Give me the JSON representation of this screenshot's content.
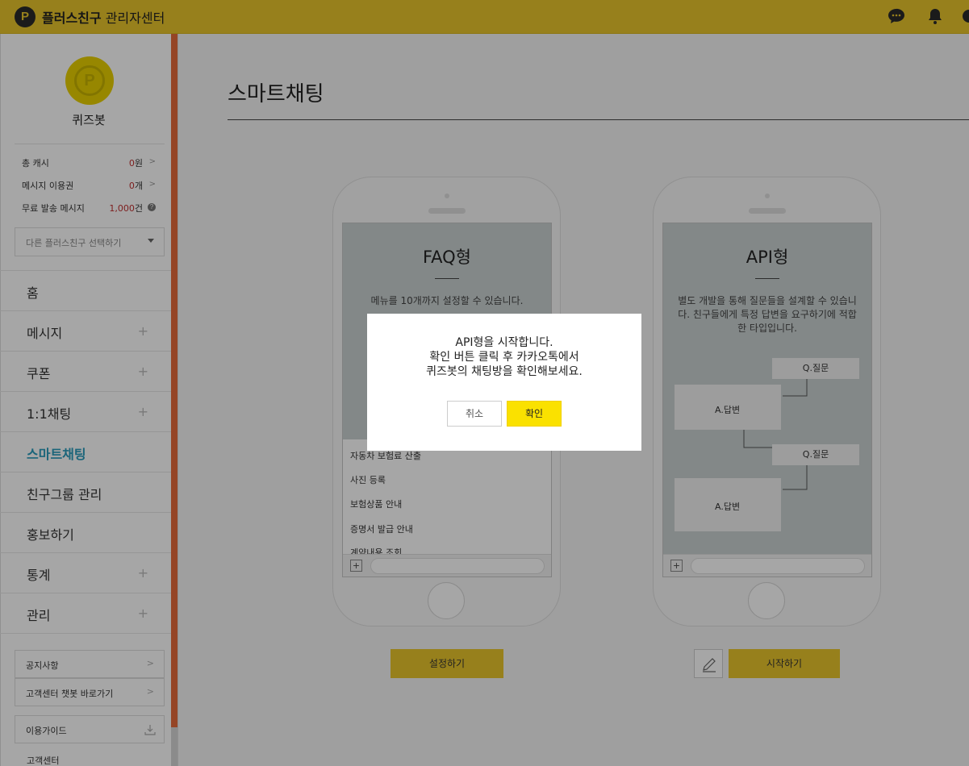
{
  "header": {
    "logo_glyph": "P",
    "brand_bold": "플러스친구",
    "brand_rest": " 관리자센터",
    "icons": [
      "chat-icon",
      "bell-icon",
      "settings-icon"
    ],
    "accent_color": "#e8c52b"
  },
  "profile": {
    "name": "퀴즈봇",
    "avatar_glyph": "P"
  },
  "stats": [
    {
      "label": "총 캐시",
      "value": "0",
      "unit": "원",
      "action": "chevron-right-icon"
    },
    {
      "label": "메시지 이용권",
      "value": "0",
      "unit": "개",
      "action": "chevron-right-icon"
    },
    {
      "label": "무료 발송 메시지",
      "value": "1,000",
      "unit": "건",
      "action": "help-icon"
    }
  ],
  "account_select": {
    "placeholder": "다른 플러스친구 선택하기"
  },
  "nav": [
    {
      "label": "홈",
      "expandable": false,
      "active": false
    },
    {
      "label": "메시지",
      "expandable": true,
      "active": false
    },
    {
      "label": "쿠폰",
      "expandable": true,
      "active": false
    },
    {
      "label": "1:1채팅",
      "expandable": true,
      "active": false
    },
    {
      "label": "스마트채팅",
      "expandable": false,
      "active": true
    },
    {
      "label": "친구그룹 관리",
      "expandable": false,
      "active": false
    },
    {
      "label": "홍보하기",
      "expandable": false,
      "active": false
    },
    {
      "label": "통계",
      "expandable": true,
      "active": false
    },
    {
      "label": "관리",
      "expandable": true,
      "active": false
    }
  ],
  "side_links": {
    "notice": "공지사항",
    "chatbot": "고객센터 챗봇 바로가기",
    "guide": "이용가이드",
    "customer_center": "고객센터"
  },
  "page": {
    "title": "스마트채팅"
  },
  "faq_card": {
    "title": "FAQ형",
    "description": "메뉴를 10개까지 설정할 수 있습니다.",
    "menu_items": [
      "자동차 보험료 산출",
      "사진 등록",
      "보험상품 안내",
      "증명서 발급 안내",
      "계약내용 조회"
    ],
    "button": "설정하기"
  },
  "api_card": {
    "title": "API형",
    "description": "별도 개발을 통해 질문들을 설계할 수 있습니다. 친구들에게 특정 답변을 요구하기에 적합한 타입입니다.",
    "question_1": "Q.질문",
    "answer_1": "A.답변",
    "question_2": "Q.질문",
    "answer_2": "A.답변",
    "button": "시작하기"
  },
  "modal": {
    "line1": "API형을 시작합니다.",
    "line2": "확인 버튼 클릭 후 카카오톡에서",
    "line3": "퀴즈봇의 채팅방을 확인해보세요.",
    "cancel": "취소",
    "confirm": "확인",
    "confirm_color": "#fae100"
  }
}
